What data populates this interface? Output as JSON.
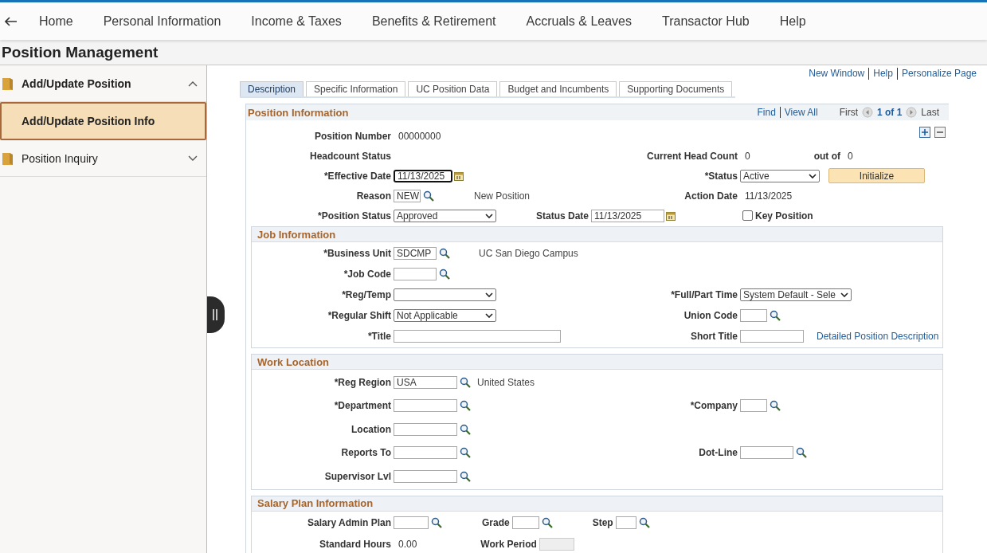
{
  "nav": {
    "items": [
      "Home",
      "Personal Information",
      "Income & Taxes",
      "Benefits & Retirement",
      "Accruals & Leaves",
      "Transactor Hub",
      "Help"
    ]
  },
  "page_title": "Position Management",
  "sidebar": {
    "items": [
      {
        "label": "Add/Update Position",
        "expanded": true,
        "children": [
          {
            "label": "Add/Update Position Info",
            "selected": true
          }
        ]
      },
      {
        "label": "Position Inquiry",
        "expanded": false
      }
    ]
  },
  "top_links": [
    "New Window",
    "Help",
    "Personalize Page"
  ],
  "tabs": [
    {
      "label": "Description",
      "selected": true
    },
    {
      "label": "Specific Information",
      "selected": false
    },
    {
      "label": "UC Position Data",
      "selected": false
    },
    {
      "label": "Budget and Incumbents",
      "selected": false
    },
    {
      "label": "Supporting Documents",
      "selected": false
    }
  ],
  "position_information": {
    "title": "Position Information",
    "pager": {
      "find": "Find",
      "view_all": "View All",
      "first": "First",
      "count": "1 of 1",
      "last": "Last"
    },
    "rows": [
      {
        "left": [
          {
            "label": "Position Number",
            "kind": "display",
            "value": "00000000"
          }
        ],
        "right": []
      },
      {
        "left": [
          {
            "label": "Headcount Status",
            "kind": "heading"
          }
        ],
        "right": [
          {
            "label": "Current Head Count",
            "kind": "display",
            "value": "0"
          },
          {
            "label": "out of",
            "kind": "display",
            "value": "0"
          }
        ]
      },
      {
        "left": [
          {
            "label": "*Effective Date",
            "kind": "date",
            "value": "11/13/2025",
            "focused": true
          }
        ],
        "right": [
          {
            "label": "*Status",
            "kind": "select",
            "value": "Active"
          },
          {
            "label": "Initialize",
            "kind": "button"
          }
        ]
      },
      {
        "left": [
          {
            "label": "Reason",
            "kind": "text",
            "value": "NEW",
            "lookup": true,
            "note": "New Position"
          }
        ],
        "right": [
          {
            "label": "Action Date",
            "kind": "display",
            "value": "11/13/2025"
          }
        ]
      },
      {
        "left": [
          {
            "label": "*Position Status",
            "kind": "select",
            "value": "Approved"
          },
          {
            "label": "Status Date",
            "kind": "date",
            "value": "11/13/2025"
          }
        ],
        "right": [
          {
            "label": "Key Position",
            "kind": "checkbox",
            "checked": false
          }
        ]
      }
    ],
    "sections": [
      {
        "title": "Job Information",
        "rows": [
          {
            "left": [
              {
                "label": "*Business Unit",
                "kind": "text",
                "value": "SDCMP",
                "lookup": true,
                "note": "UC San Diego Campus"
              }
            ],
            "right": []
          },
          {
            "left": [
              {
                "label": "*Job Code",
                "kind": "text",
                "lookup": true
              }
            ],
            "right": []
          },
          {
            "left": [
              {
                "label": "*Reg/Temp",
                "kind": "select"
              }
            ],
            "right": [
              {
                "label": "*Full/Part Time",
                "kind": "select",
                "value": "System Default - Sele"
              }
            ]
          },
          {
            "left": [
              {
                "label": "*Regular Shift",
                "kind": "select",
                "value": "Not Applicable"
              }
            ],
            "right": [
              {
                "label": "Union Code",
                "kind": "text",
                "lookup": true
              }
            ]
          },
          {
            "left": [
              {
                "label": "*Title",
                "kind": "text"
              }
            ],
            "right": [
              {
                "label": "Short Title",
                "kind": "text"
              },
              {
                "label": "Detailed Position Description",
                "kind": "link"
              }
            ]
          }
        ]
      },
      {
        "title": "Work Location",
        "rows": [
          {
            "left": [
              {
                "label": "*Reg Region",
                "kind": "text",
                "value": "USA",
                "lookup": true,
                "note": "United States"
              }
            ],
            "right": []
          },
          {
            "left": [
              {
                "label": "*Department",
                "kind": "text",
                "lookup": true
              }
            ],
            "right": [
              {
                "label": "*Company",
                "kind": "text",
                "lookup": true
              }
            ]
          },
          {
            "left": [
              {
                "label": "Location",
                "kind": "text",
                "lookup": true
              }
            ],
            "right": []
          },
          {
            "left": [
              {
                "label": "Reports To",
                "kind": "text",
                "lookup": true
              }
            ],
            "right": [
              {
                "label": "Dot-Line",
                "kind": "text",
                "lookup": true
              }
            ]
          },
          {
            "left": [
              {
                "label": "Supervisor Lvl",
                "kind": "text",
                "lookup": true
              }
            ],
            "right": []
          }
        ]
      },
      {
        "title": "Salary Plan Information",
        "rows": [
          {
            "left": [
              {
                "label": "Salary Admin Plan",
                "kind": "text",
                "lookup": true
              },
              {
                "label": "Grade",
                "kind": "text",
                "lookup": true
              },
              {
                "label": "Step",
                "kind": "text",
                "lookup": true
              }
            ],
            "right": []
          },
          {
            "left": [
              {
                "label": "Standard Hours",
                "kind": "display",
                "value": "0.00"
              },
              {
                "label": "Work Period",
                "kind": "disabled"
              }
            ],
            "right": []
          }
        ]
      }
    ]
  }
}
